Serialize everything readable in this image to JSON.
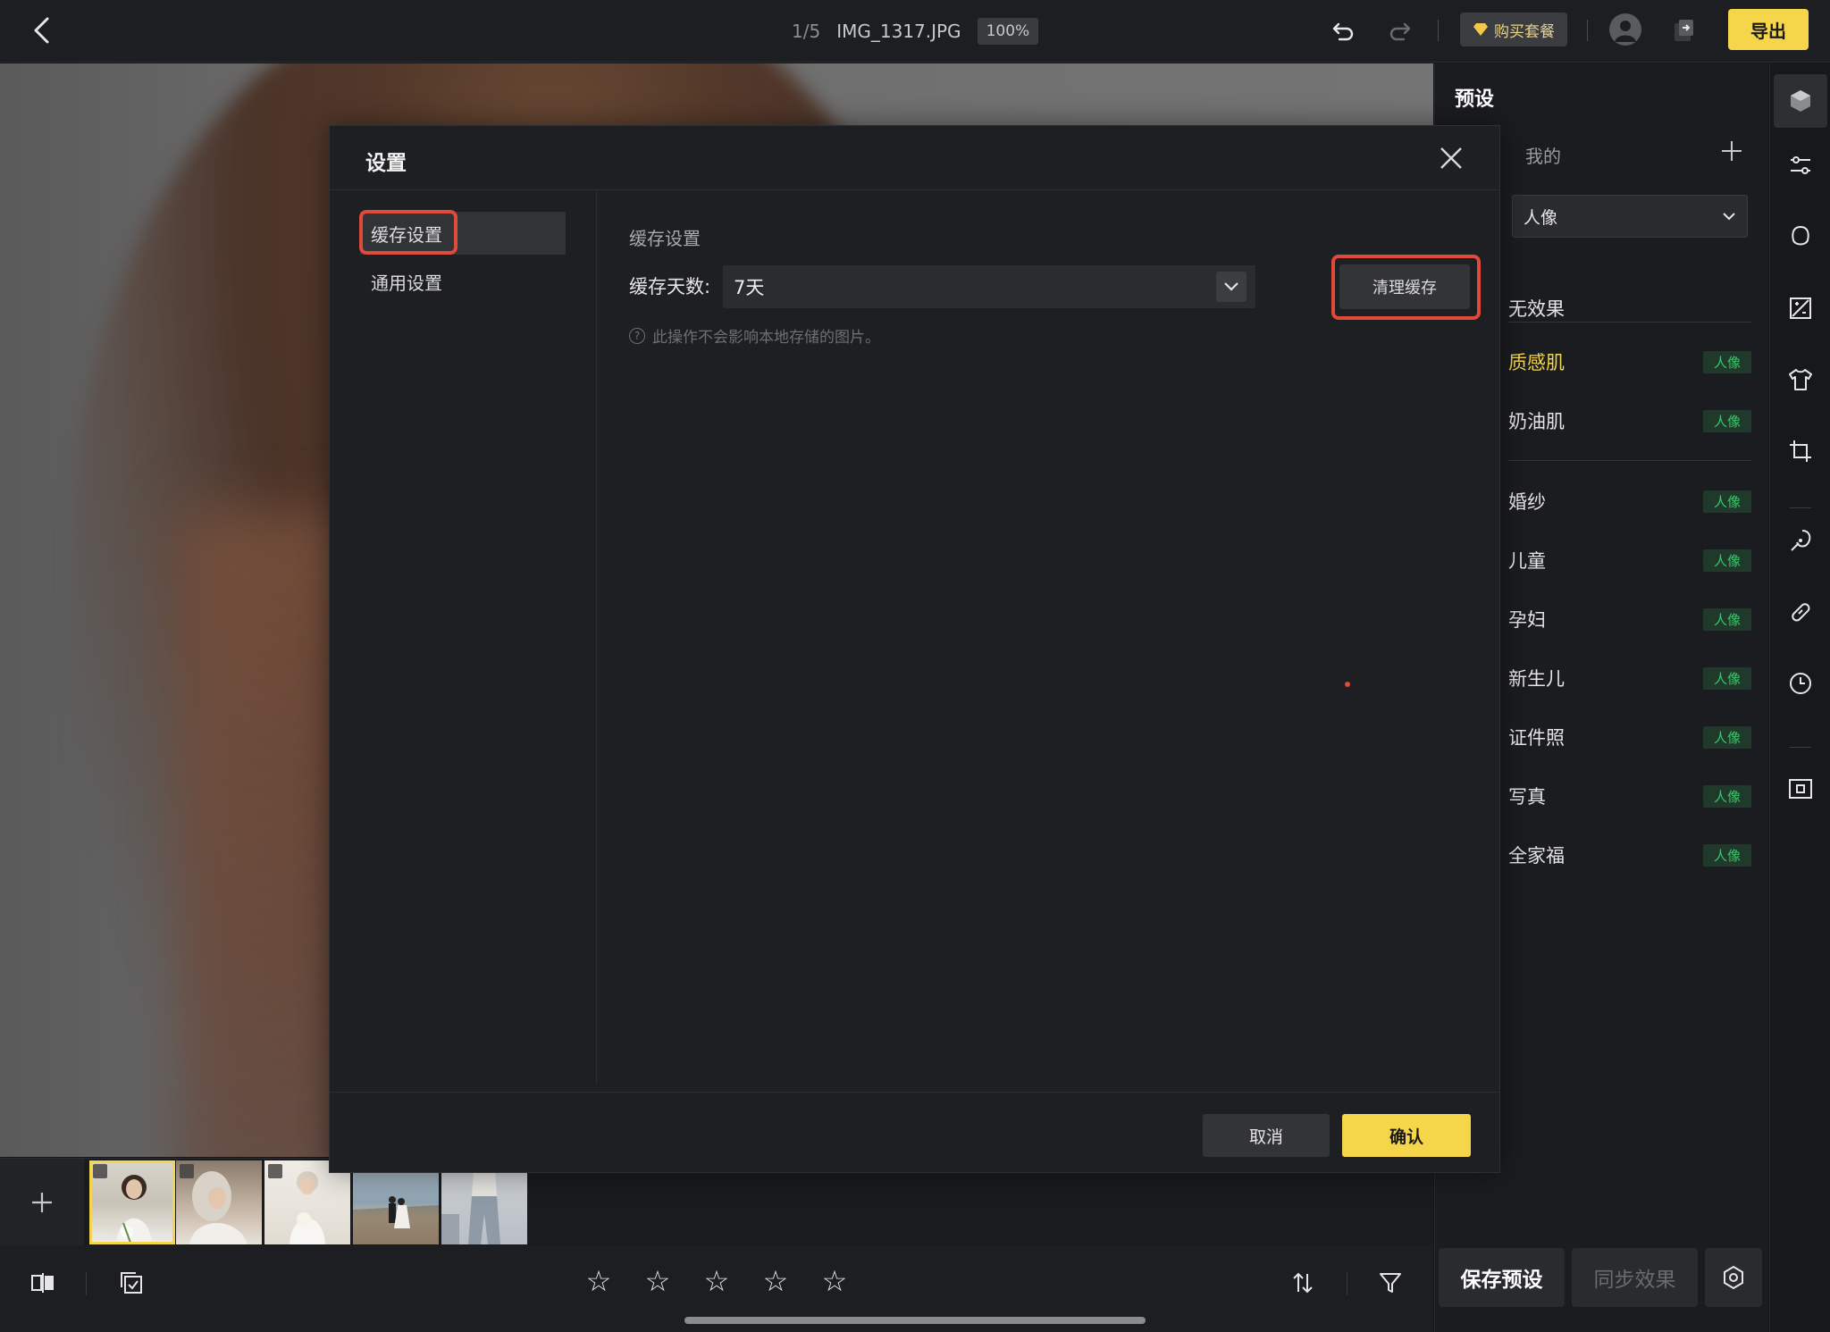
{
  "topbar": {
    "page_counter": "1/5",
    "filename": "IMG_1317.JPG",
    "zoom": "100%",
    "buy_label": "购买套餐",
    "export_label": "导出"
  },
  "panel": {
    "title": "预设",
    "mine_label": "我的",
    "category_select": "人像",
    "no_effect": "无效果",
    "presets_group1": [
      {
        "name": "质感肌",
        "tag": "人像"
      },
      {
        "name": "奶油肌",
        "tag": "人像"
      }
    ],
    "presets_group2": [
      {
        "name": "婚纱",
        "tag": "人像"
      },
      {
        "name": "儿童",
        "tag": "人像"
      },
      {
        "name": "孕妇",
        "tag": "人像"
      },
      {
        "name": "新生儿",
        "tag": "人像"
      },
      {
        "name": "证件照",
        "tag": "人像"
      },
      {
        "name": "写真",
        "tag": "人像"
      },
      {
        "name": "全家福",
        "tag": "人像"
      }
    ],
    "save_preset_label": "保存预设",
    "sync_effect_label": "同步效果"
  },
  "modal": {
    "title": "设置",
    "nav": [
      "缓存设置",
      "通用设置"
    ],
    "section_title": "缓存设置",
    "cache_days_label": "缓存天数:",
    "cache_days_value": "7天",
    "clear_cache_label": "清理缓存",
    "hint": "此操作不会影响本地存储的图片。",
    "cancel_label": "取消",
    "confirm_label": "确认"
  },
  "colors": {
    "accent": "#f5d64a",
    "highlight": "#e04a3a",
    "tag_text": "#3cc46e"
  }
}
